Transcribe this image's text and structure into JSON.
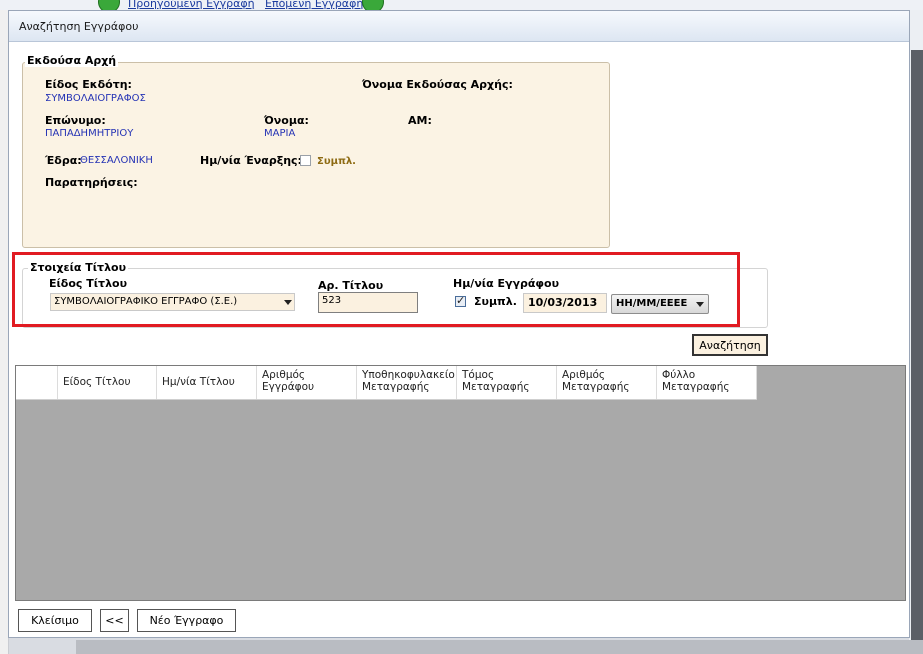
{
  "background": {
    "nav_prev_label": "Προηγούμενη Εγγραφή",
    "nav_next_label": "Επόμενη Εγγραφή"
  },
  "dialog": {
    "title": "Αναζήτηση Εγγράφου"
  },
  "authority": {
    "group_title": "Εκδούσα Αρχή",
    "issuer_type_label": "Είδος Εκδότη:",
    "issuer_type_value": "ΣΥΜΒΟΛΑΙΟΓΡΑΦΟΣ",
    "authority_name_label": "Όνομα Εκδούσας Αρχής:",
    "surname_label": "Επώνυμο:",
    "surname_value": "ΠΑΠΑΔΗΜΗΤΡΙΟΥ",
    "name_label": "Όνομα:",
    "name_value": "ΜΑΡΙΑ",
    "am_label": "ΑΜ:",
    "seat_label": "Έδρα:",
    "seat_value": "ΘΕΣΣΑΛΟΝΙΚΗ",
    "start_date_label": "Ημ/νία Έναρξης:",
    "start_date_checkbox_label": "Συμπλ.",
    "notes_label": "Παρατηρήσεις:"
  },
  "title_info": {
    "group_title": "Στοιχεία Τίτλου",
    "title_type_label": "Είδος Τίτλου",
    "title_type_value": "ΣΥΜΒΟΛΑΙΟΓΡΑΦΙΚΟ ΕΓΓΡΑΦΟ (Σ.Ε.)",
    "title_number_label": "Αρ. Τίτλου",
    "title_number_value": "523",
    "document_date_label": "Ημ/νία Εγγράφου",
    "document_date_checkbox_label": "Συμπλ.",
    "document_date_value": "10/03/2013",
    "date_format_value": "ΗΗ/ΜΜ/ΕΕΕΕ"
  },
  "search_button_label": "Αναζήτηση",
  "grid": {
    "columns": [
      "Είδος Τίτλου",
      "Ημ/νία Τίτλου",
      "Αριθμός Εγγράφου",
      "Υποθηκοφυλακείο Μεταγραφής",
      "Τόμος Μεταγραφής",
      "Αριθμός Μεταγραφής",
      "Φύλλο Μεταγραφής"
    ]
  },
  "footer": {
    "close_label": "Κλείσιμο",
    "back_label": "<<",
    "new_document_label": "Νέο Έγγραφο"
  },
  "colors": {
    "accent_red": "#e11b22",
    "field_background": "#fbf1e0",
    "value_text": "#2432b4",
    "grid_background": "#a9a9a9"
  }
}
